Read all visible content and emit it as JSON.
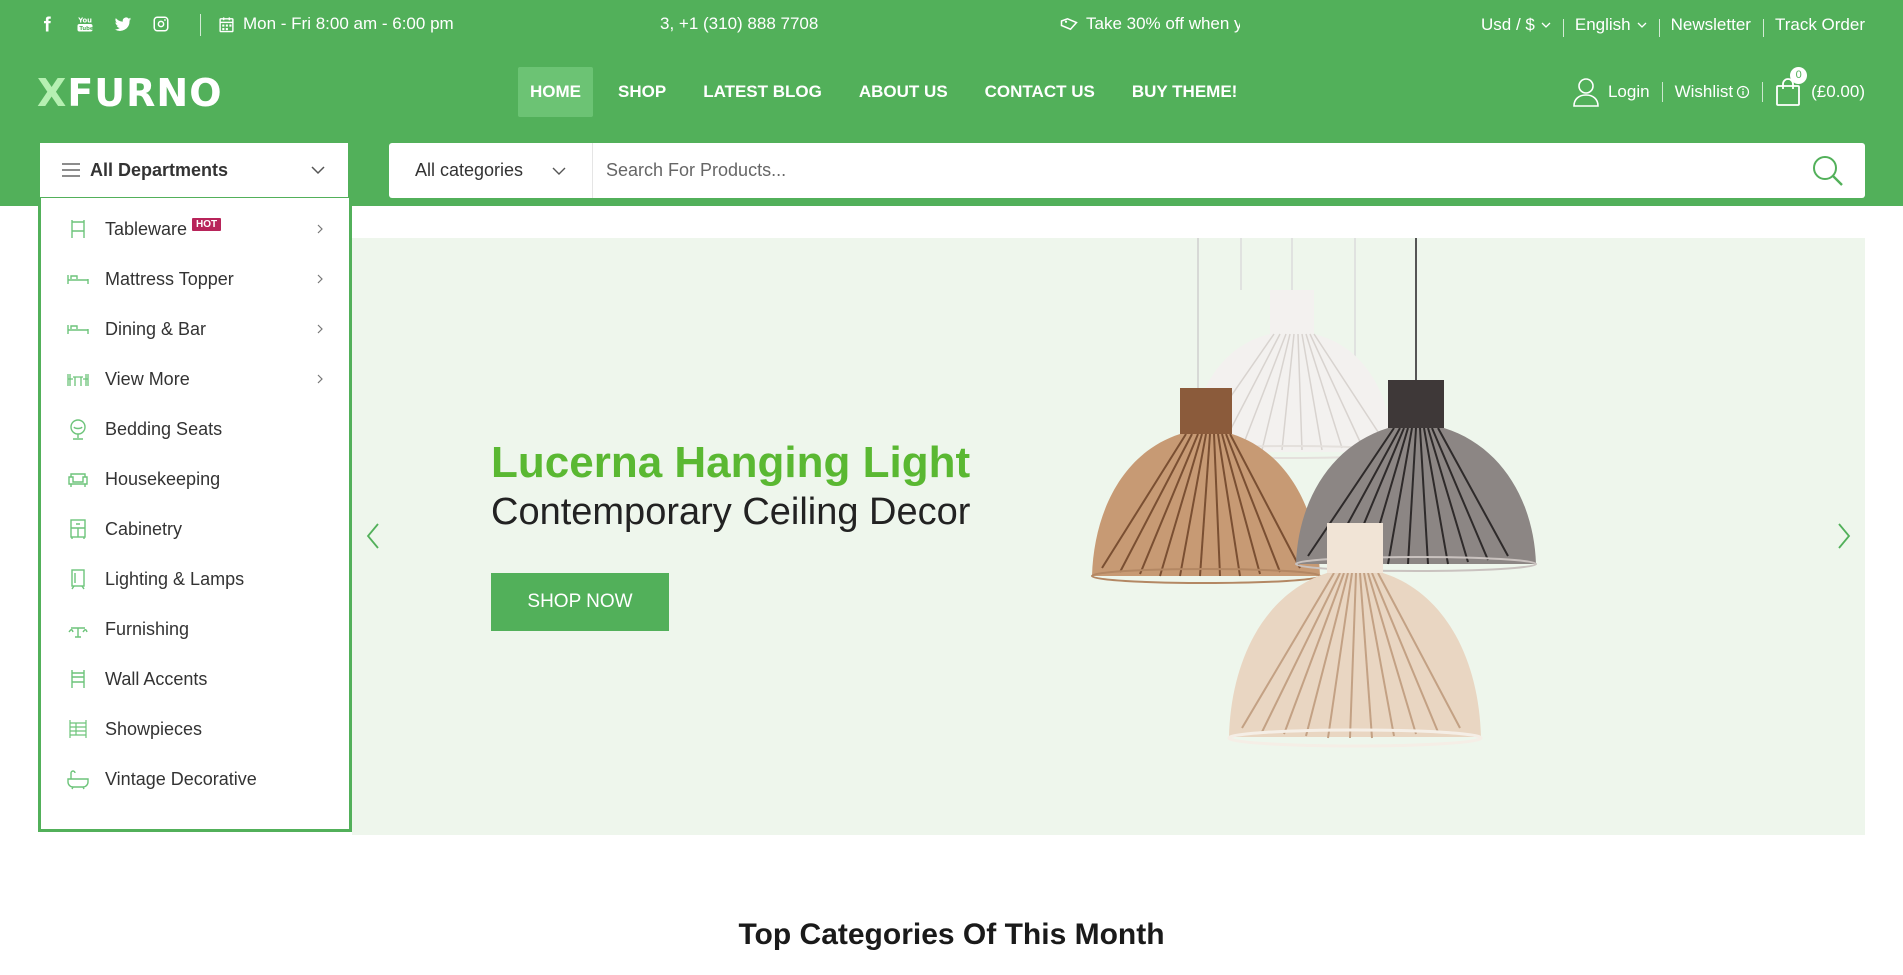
{
  "topbar": {
    "social_icons": [
      "facebook-icon",
      "youtube-icon",
      "twitter-icon",
      "instagram-icon"
    ],
    "hours": "Mon - Fri 8:00 am - 6:00 pm",
    "ticker_phone": "3, +1 (310) 888 7708",
    "ticker_promo": "Take 30% off when y",
    "currency": "Usd / $",
    "language": "English",
    "newsletter": "Newsletter",
    "track_order": "Track Order"
  },
  "header": {
    "logo_x": "X",
    "logo_rest": "FURNO",
    "nav": [
      "HOME",
      "SHOP",
      "LATEST BLOG",
      "ABOUT US",
      "CONTACT US",
      "BUY THEME!"
    ],
    "login": "Login",
    "wishlist": "Wishlist",
    "cart_count": "0",
    "cart_total": "(£0.00)"
  },
  "search": {
    "departments_label": "All Departments",
    "category": "All categories",
    "placeholder": "Search For Products..."
  },
  "departments": [
    {
      "label": "Tableware",
      "hot": "HOT",
      "has_submenu": true,
      "icon": "chair-icon"
    },
    {
      "label": "Mattress Topper",
      "has_submenu": true,
      "icon": "bed-icon"
    },
    {
      "label": "Dining & Bar",
      "has_submenu": true,
      "icon": "bed-icon"
    },
    {
      "label": "View More",
      "has_submenu": true,
      "icon": "dining-table-icon"
    },
    {
      "label": "Bedding Seats",
      "has_submenu": false,
      "icon": "lamp-icon"
    },
    {
      "label": "Housekeeping",
      "has_submenu": false,
      "icon": "sofa-icon"
    },
    {
      "label": "Cabinetry",
      "has_submenu": false,
      "icon": "cabinet-icon"
    },
    {
      "label": "Lighting & Lamps",
      "has_submenu": false,
      "icon": "mirror-icon"
    },
    {
      "label": "Furnishing",
      "has_submenu": false,
      "icon": "table-icon"
    },
    {
      "label": "Wall Accents",
      "has_submenu": false,
      "icon": "chair-icon"
    },
    {
      "label": "Showpieces",
      "has_submenu": false,
      "icon": "shelf-icon"
    },
    {
      "label": "Vintage Decorative",
      "has_submenu": false,
      "icon": "bathtub-icon"
    }
  ],
  "hero": {
    "title": "Lucerna Hanging Light",
    "subtitle": "Contemporary Ceiling Decor",
    "button": "SHOP NOW"
  },
  "section_title": "Top Categories Of This Month",
  "colors": {
    "brand": "#52b05a",
    "hero_title": "#5ab832",
    "hero_bg": "#eef6ec",
    "hot_badge": "#b8245a"
  }
}
